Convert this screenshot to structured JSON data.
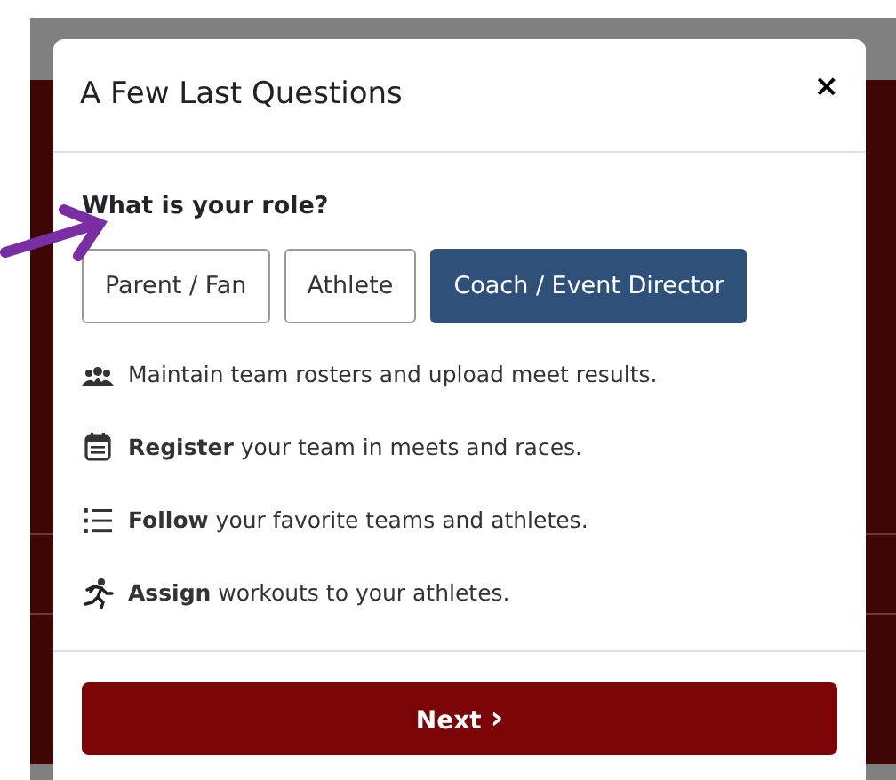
{
  "modal": {
    "title": "A Few Last Questions",
    "close": "×",
    "question": "What is your role?",
    "roles": [
      {
        "label": "Parent / Fan",
        "selected": false
      },
      {
        "label": "Athlete",
        "selected": false
      },
      {
        "label": "Coach / Event Director",
        "selected": true
      }
    ],
    "features": [
      {
        "kind": "people",
        "text": "Maintain team rosters and upload meet results."
      },
      {
        "kind": "calendar",
        "text": "**Register** your team in meets and races."
      },
      {
        "kind": "list",
        "text": "**Follow** your favorite teams and athletes."
      },
      {
        "kind": "runner",
        "text": "**Assign** workouts to your athletes."
      }
    ],
    "next": {
      "label": "Next",
      "icon": "›"
    }
  }
}
